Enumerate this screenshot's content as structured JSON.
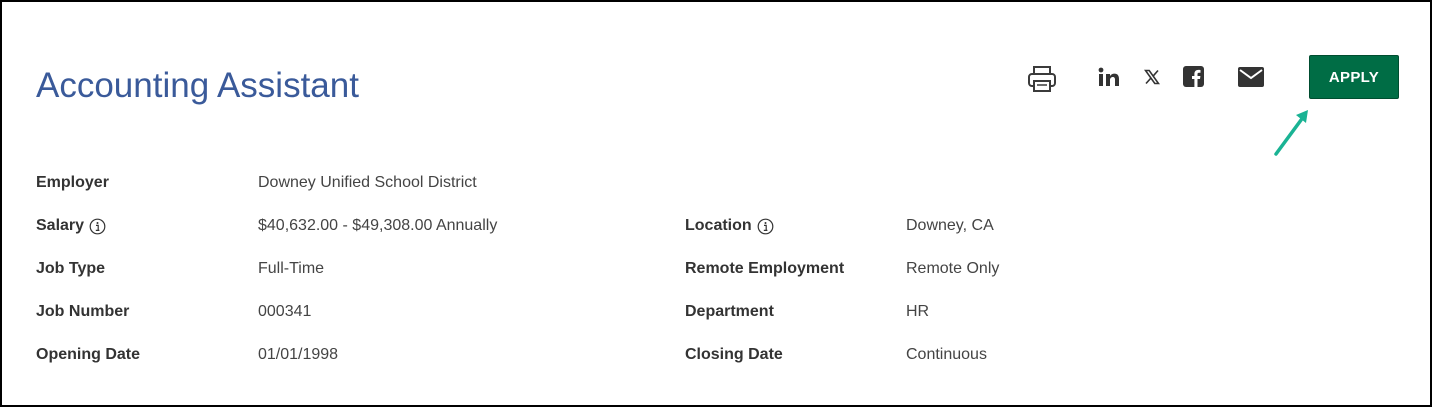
{
  "job": {
    "title": "Accounting Assistant"
  },
  "toolbar": {
    "icons": [
      "printer-icon",
      "linkedin-icon",
      "x-icon",
      "facebook-icon",
      "email-icon"
    ],
    "apply_label": "APPLY"
  },
  "details": {
    "employer_label": "Employer",
    "employer_value": "Downey Unified School District",
    "salary_label": "Salary",
    "salary_value": "$40,632.00 - $49,308.00 Annually",
    "location_label": "Location",
    "location_value": "Downey, CA",
    "job_type_label": "Job Type",
    "job_type_value": "Full-Time",
    "remote_label": "Remote Employment",
    "remote_value": "Remote Only",
    "job_number_label": "Job Number",
    "job_number_value": "000341",
    "department_label": "Department",
    "department_value": "HR",
    "opening_date_label": "Opening Date",
    "opening_date_value": "01/01/1998",
    "closing_date_label": "Closing Date",
    "closing_date_value": "Continuous"
  },
  "colors": {
    "title": "#3a5a9a",
    "apply_button": "#006d45",
    "arrow": "#1ab394",
    "frame_border": "#000000"
  }
}
